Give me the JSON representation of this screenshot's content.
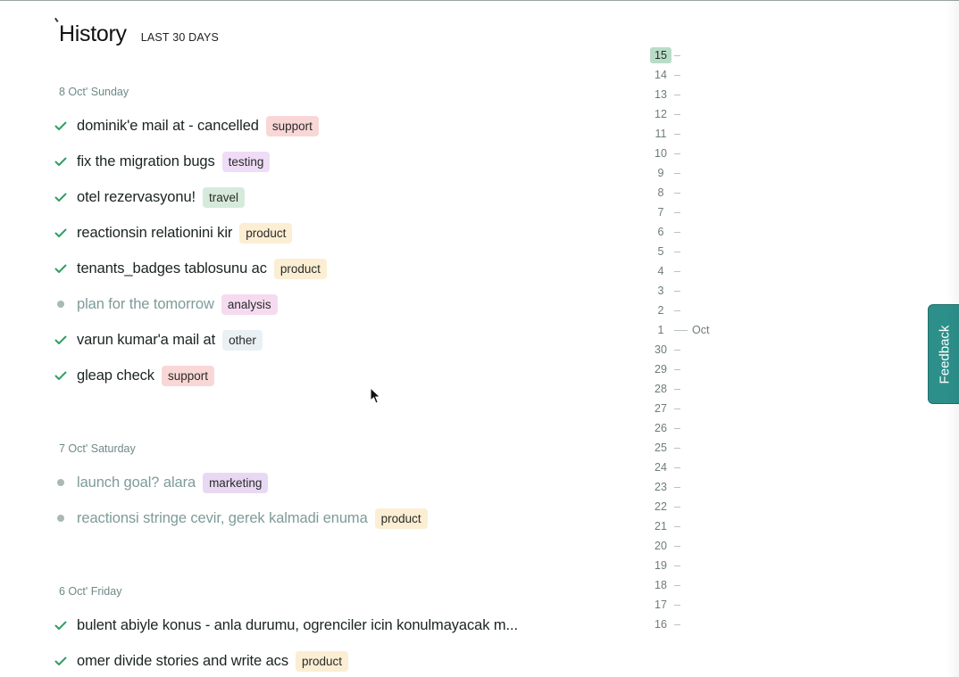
{
  "header": {
    "title": "History",
    "range": "LAST 30 DAYS"
  },
  "colors": {
    "check": "#2f9f62",
    "tag_support": "#f8d7d6",
    "tag_testing": "#efdcf6",
    "tag_travel": "#d6eadb",
    "tag_product": "#fbeed3",
    "tag_analysis": "#f5dbf0",
    "tag_other": "#e9f1f4",
    "tag_marketing": "#e9d8f4",
    "feedback": "#2c8f8a"
  },
  "days": [
    {
      "label": "8 Oct' Sunday",
      "tasks": [
        {
          "title": "dominik'e mail at - cancelled",
          "tag": "support",
          "status": "done"
        },
        {
          "title": "fix the migration bugs",
          "tag": "testing",
          "status": "done"
        },
        {
          "title": "otel rezervasyonu!",
          "tag": "travel",
          "status": "done"
        },
        {
          "title": "reactionsin relationini kir",
          "tag": "product",
          "status": "done"
        },
        {
          "title": "tenants_badges tablosunu ac",
          "tag": "product",
          "status": "done"
        },
        {
          "title": "plan for the tomorrow",
          "tag": "analysis",
          "status": "pending"
        },
        {
          "title": "varun kumar'a mail at",
          "tag": "other",
          "status": "done"
        },
        {
          "title": "gleap check",
          "tag": "support",
          "status": "done"
        }
      ]
    },
    {
      "label": "7 Oct' Saturday",
      "tasks": [
        {
          "title": "launch goal? alara",
          "tag": "marketing",
          "status": "pending"
        },
        {
          "title": "reactionsi stringe cevir, gerek kalmadi enuma",
          "tag": "product",
          "status": "pending"
        }
      ]
    },
    {
      "label": "6 Oct' Friday",
      "tasks": [
        {
          "title": "bulent abiyle konus - anla durumu, ogrenciler icin konulmayacak m...",
          "tag": "",
          "status": "done"
        },
        {
          "title": "omer divide stories and write acs",
          "tag": "product",
          "status": "done"
        }
      ]
    }
  ],
  "timeline": {
    "days": [
      "15",
      "14",
      "13",
      "12",
      "11",
      "10",
      "9",
      "8",
      "7",
      "6",
      "5",
      "4",
      "3",
      "2",
      "1",
      "30",
      "29",
      "28",
      "27",
      "26",
      "25",
      "24",
      "23",
      "22",
      "21",
      "20",
      "19",
      "18",
      "17",
      "16"
    ],
    "current": "15",
    "month_marker": {
      "day": "1",
      "label": "Oct"
    }
  },
  "feedback": {
    "label": "Feedback"
  },
  "icons": {
    "done": "check-icon",
    "pending": "dot-icon",
    "cursor": "mouse-pointer-icon"
  }
}
